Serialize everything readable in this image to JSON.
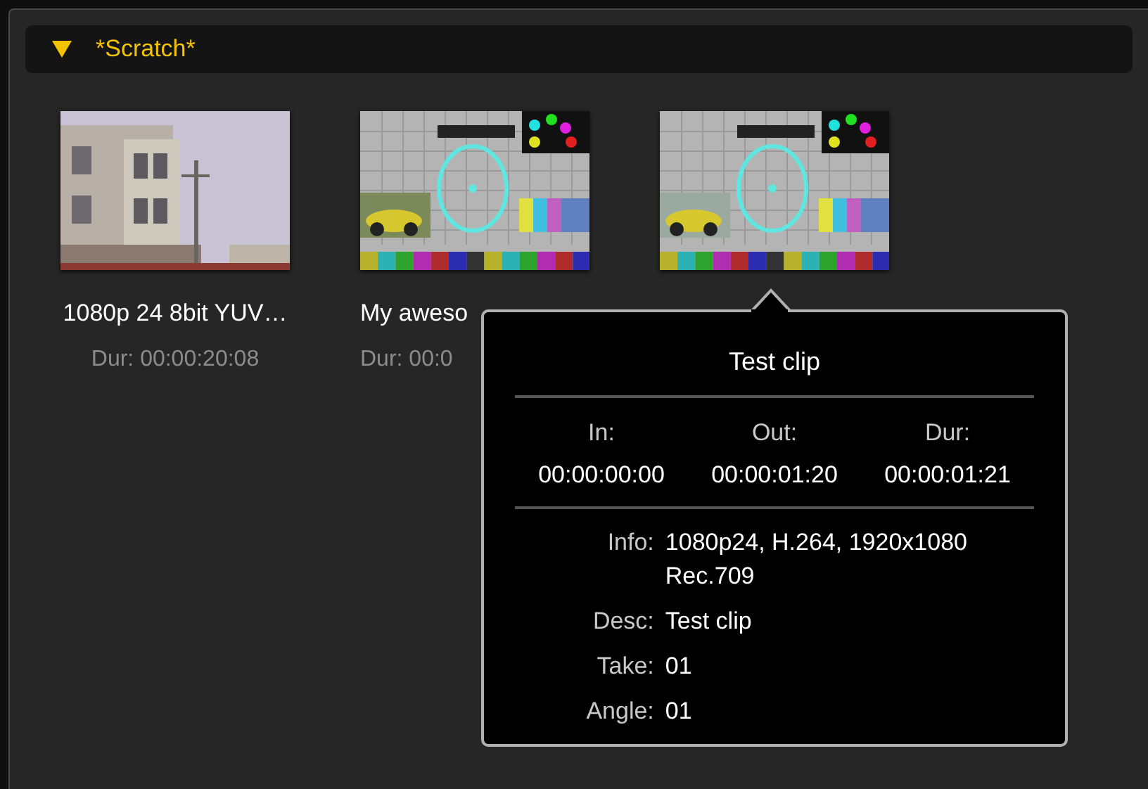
{
  "bin": {
    "title": "*Scratch*",
    "expanded": true
  },
  "clips": [
    {
      "kind": "picture",
      "name": "1080p 24 8bit YUV…",
      "duration": "Dur: 00:00:20:08"
    },
    {
      "kind": "picture",
      "name": "My aweso",
      "duration": "Dur: 00:0"
    },
    {
      "kind": "picture"
    }
  ],
  "popover": {
    "title": "Test clip",
    "timecodes": [
      {
        "label": "In:",
        "value": "00:00:00:00"
      },
      {
        "label": "Out:",
        "value": "00:00:01:20"
      },
      {
        "label": "Dur:",
        "value": "00:00:01:21"
      }
    ],
    "details": [
      {
        "label": "Info:",
        "value": "1080p24, H.264, 1920x1080 Rec.709"
      },
      {
        "label": "Desc:",
        "value": "Test clip"
      },
      {
        "label": "Take:",
        "value": "01"
      },
      {
        "label": "Angle:",
        "value": "01"
      }
    ]
  }
}
